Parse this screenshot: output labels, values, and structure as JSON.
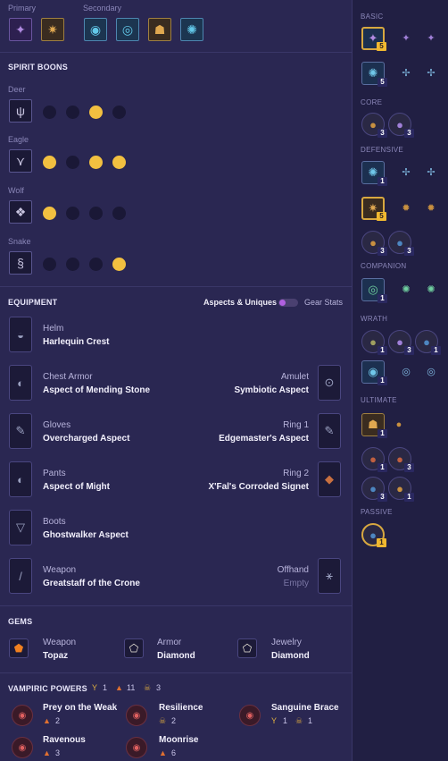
{
  "skills": {
    "primary_label": "Primary",
    "secondary_label": "Secondary"
  },
  "spirit_boons": {
    "title": "SPIRIT BOONS",
    "groups": [
      {
        "name": "Deer",
        "active": [
          false,
          false,
          true,
          false
        ]
      },
      {
        "name": "Eagle",
        "active": [
          true,
          false,
          true,
          true
        ]
      },
      {
        "name": "Wolf",
        "active": [
          true,
          false,
          false,
          false
        ]
      },
      {
        "name": "Snake",
        "active": [
          false,
          false,
          false,
          true
        ]
      }
    ]
  },
  "equipment": {
    "title": "EQUIPMENT",
    "toggle_left": "Aspects & Uniques",
    "toggle_right": "Gear Stats",
    "helm": {
      "slot": "Helm",
      "name": "Harlequin Crest"
    },
    "chest": {
      "slot": "Chest Armor",
      "name": "Aspect of Mending Stone"
    },
    "amulet": {
      "slot": "Amulet",
      "name": "Symbiotic Aspect"
    },
    "gloves": {
      "slot": "Gloves",
      "name": "Overcharged Aspect"
    },
    "ring1": {
      "slot": "Ring 1",
      "name": "Edgemaster's Aspect"
    },
    "pants": {
      "slot": "Pants",
      "name": "Aspect of Might"
    },
    "ring2": {
      "slot": "Ring 2",
      "name": "X'Fal's Corroded Signet"
    },
    "boots": {
      "slot": "Boots",
      "name": "Ghostwalker Aspect"
    },
    "weapon": {
      "slot": "Weapon",
      "name": "Greatstaff of the Crone"
    },
    "offhand": {
      "slot": "Offhand",
      "name": "Empty"
    }
  },
  "gems": {
    "title": "GEMS",
    "weapon": {
      "slot": "Weapon",
      "name": "Topaz"
    },
    "armor": {
      "slot": "Armor",
      "name": "Diamond"
    },
    "jewelry": {
      "slot": "Jewelry",
      "name": "Diamond"
    }
  },
  "vampiric": {
    "title": "VAMPIRIC POWERS",
    "counts": {
      "goblet": "1",
      "flame": "11",
      "skull": "3"
    },
    "powers": {
      "prey": {
        "name": "Prey on the Weak",
        "count": "2"
      },
      "resilience": {
        "name": "Resilience",
        "count": "2"
      },
      "sanguine": {
        "name": "Sanguine Brace",
        "c1": "1",
        "c2": "1"
      },
      "ravenous": {
        "name": "Ravenous",
        "count": "3"
      },
      "moonrise": {
        "name": "Moonrise",
        "count": "6"
      }
    }
  },
  "tree": {
    "basic": "BASIC",
    "core": "CORE",
    "defensive": "DEFENSIVE",
    "companion": "COMPANION",
    "wrath": "WRATH",
    "ultimate": "ULTIMATE",
    "passive": "PASSIVE",
    "b1": "5",
    "b2": "5",
    "c1": "3",
    "c2": "3",
    "d1": "1",
    "d2": "5",
    "d3": "3",
    "d4": "3",
    "comp": "1",
    "w1": "1",
    "w2": "3",
    "w3": "1",
    "w4": "1",
    "u1": "1",
    "u2": "1",
    "u3": "3",
    "u4": "3",
    "u5": "1",
    "p1": "1"
  }
}
